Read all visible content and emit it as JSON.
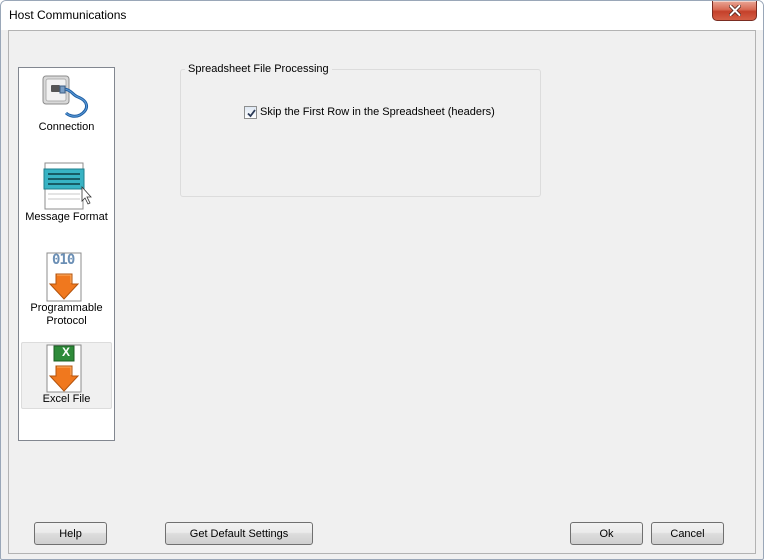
{
  "window": {
    "title": "Host Communications"
  },
  "nav": {
    "items": [
      {
        "label": "Connection",
        "icon": "connection-icon",
        "selected": false
      },
      {
        "label": "Message Format",
        "icon": "message-format-icon",
        "selected": false
      },
      {
        "label": "Programmable Protocol",
        "icon": "programmable-protocol-icon",
        "selected": false
      },
      {
        "label": "Excel File",
        "icon": "excel-file-icon",
        "selected": true
      }
    ]
  },
  "group": {
    "title": "Spreadsheet File Processing",
    "checkbox": {
      "label": "Skip the First Row in the Spreadsheet (headers)",
      "checked": true
    }
  },
  "buttons": {
    "help": "Help",
    "defaults": "Get Default Settings",
    "ok": "Ok",
    "cancel": "Cancel"
  },
  "icons": {
    "binary_text": "010",
    "excel_letter": "X"
  },
  "colors": {
    "close_button": "#c4402a",
    "arrow_orange": "#f0781e",
    "excel_green": "#2e8b3a",
    "selection_bg": "#f0f0f0"
  }
}
